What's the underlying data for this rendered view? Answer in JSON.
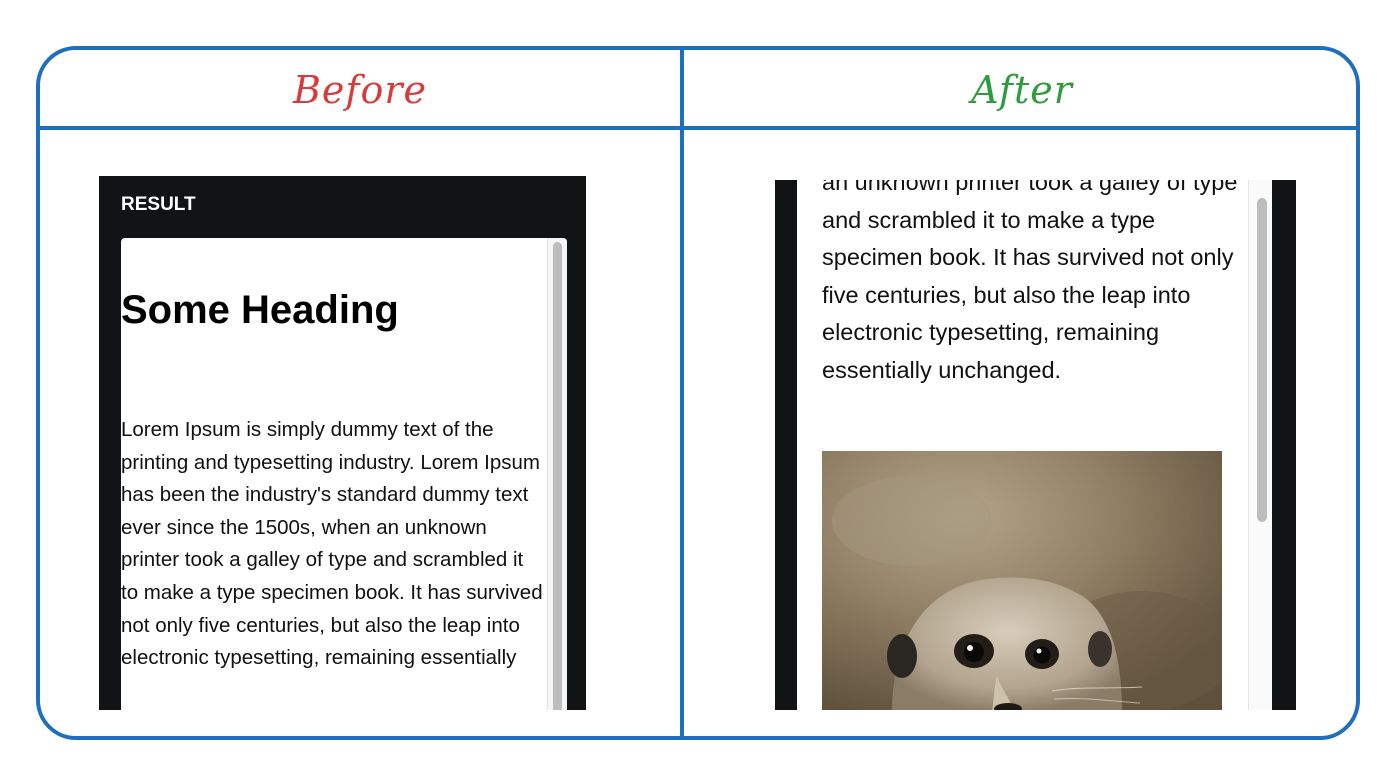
{
  "headers": {
    "before": "Before",
    "after": "After",
    "before_color": "#d93a3a",
    "after_color": "#2e9c3c",
    "border_color": "#1f6fbf"
  },
  "before": {
    "result_label": "RESULT",
    "heading": "Some Heading",
    "paragraph": "Lorem Ipsum is simply dummy text of the printing and typesetting industry. Lorem Ipsum has been the industry's standard dummy text ever since the 1500s, when an unknown printer took a galley of type and scrambled it to make a type specimen book. It has survived not only five centuries, but also the leap into electronic typesetting, remaining essentially"
  },
  "after": {
    "paragraph": "an unknown printer took a galley of type and scrambled it to make a type specimen book. It has survived not only five centuries, but also the leap into electronic typesetting, remaining essentially unchanged.",
    "image_subject": "meerkat-photo"
  }
}
